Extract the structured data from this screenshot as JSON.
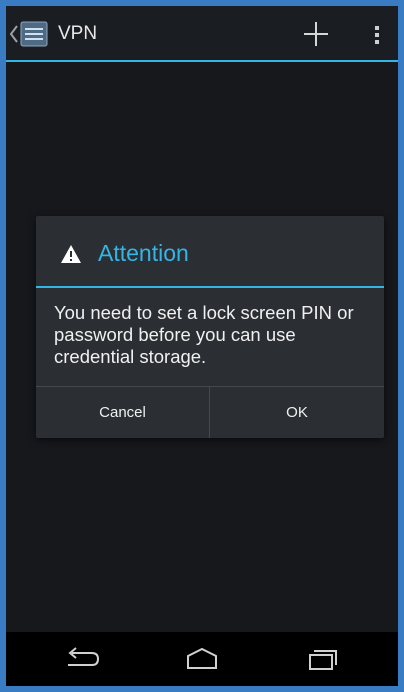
{
  "actionbar": {
    "title": "VPN"
  },
  "dialog": {
    "title": "Attention",
    "message": "You need to set a lock screen PIN or password before you can use credential storage.",
    "cancel_label": "Cancel",
    "ok_label": "OK"
  },
  "icons": {
    "up": "chevron-left-icon",
    "app": "settings-app-icon",
    "add": "plus-icon",
    "overflow": "overflow-menu-icon",
    "warning": "warning-icon",
    "back": "back-icon",
    "home": "home-icon",
    "recents": "recent-apps-icon"
  },
  "colors": {
    "accent": "#33b5e5",
    "frame": "#3a7cc4",
    "background": "#111317",
    "dialog": "#2b2e33"
  }
}
